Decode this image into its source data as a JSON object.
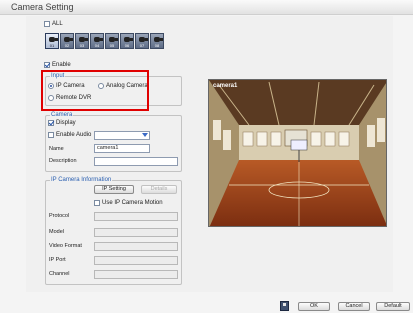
{
  "window": {
    "title": "Camera Setting"
  },
  "all": {
    "label": "ALL",
    "checked": false
  },
  "cameras": [
    {
      "num": "01",
      "selected": true
    },
    {
      "num": "02",
      "selected": false
    },
    {
      "num": "03",
      "selected": false
    },
    {
      "num": "04",
      "selected": false
    },
    {
      "num": "05",
      "selected": false
    },
    {
      "num": "06",
      "selected": false
    },
    {
      "num": "07",
      "selected": false
    },
    {
      "num": "08",
      "selected": false
    }
  ],
  "enable": {
    "label": "Enable",
    "checked": true
  },
  "input": {
    "legend": "Input",
    "ip_camera": "IP Camera",
    "analog_camera": "Analog Camera",
    "remote_dvr": "Remote DVR",
    "selected": "ip_camera"
  },
  "camera": {
    "legend": "Camera",
    "display_label": "Display",
    "display_checked": true,
    "enable_audio_label": "Enable Audio",
    "enable_audio_checked": false,
    "audio_value": "",
    "name_label": "Name",
    "name_value": "camera1",
    "description_label": "Description",
    "description_value": ""
  },
  "ip_info": {
    "legend": "IP Camera Information",
    "ip_setting": "IP Setting",
    "detail": "Details",
    "use_motion_label": "Use IP Camera Motion",
    "use_motion_checked": false,
    "protocol_label": "Protocol",
    "model_label": "Model",
    "video_format_label": "Video Format",
    "ip_port_label": "IP Port",
    "channel_label": "Channel"
  },
  "preview": {
    "label": "camera1"
  },
  "footer": {
    "ok": "OK",
    "cancel": "Cancel",
    "default": "Default"
  },
  "colors": {
    "accent": "#2a5fb0",
    "highlight_box": "#e00000"
  }
}
